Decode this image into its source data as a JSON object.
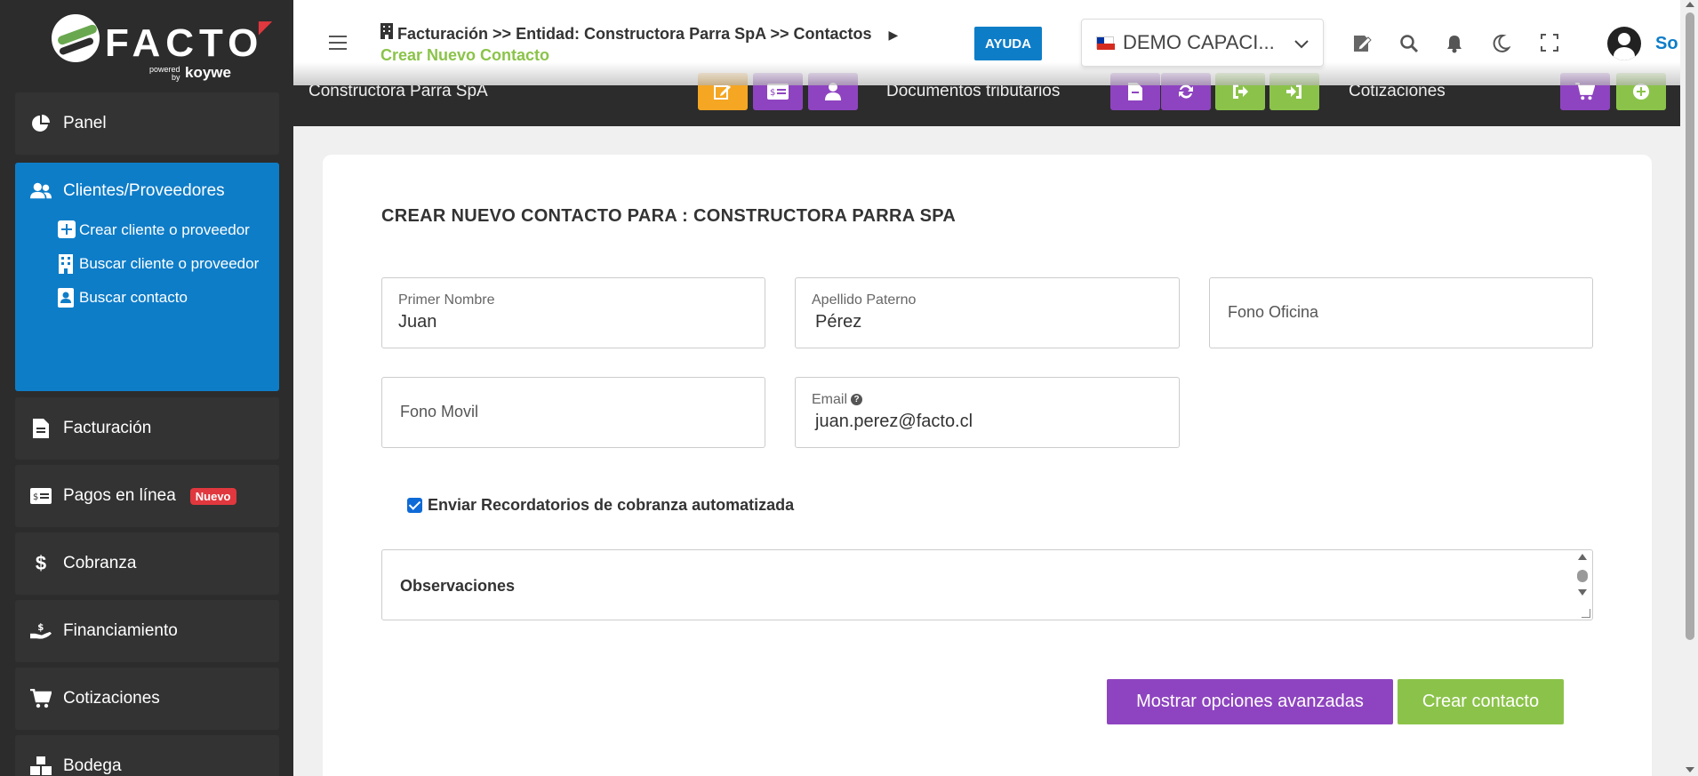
{
  "logo": {
    "word": "FACTO",
    "powered": "powered\nby",
    "brand": "koywe"
  },
  "sidebar": {
    "items": [
      {
        "label": "Panel"
      },
      {
        "label": "Clientes/Proveedores",
        "sub": [
          {
            "label": "Crear cliente o proveedor"
          },
          {
            "label": "Buscar cliente o proveedor"
          },
          {
            "label": "Buscar contacto"
          }
        ]
      },
      {
        "label": "Facturación"
      },
      {
        "label": "Pagos en línea",
        "badge": "Nuevo"
      },
      {
        "label": "Cobranza"
      },
      {
        "label": "Financiamiento"
      },
      {
        "label": "Cotizaciones"
      },
      {
        "label": "Bodega"
      }
    ]
  },
  "header": {
    "breadcrumb": "Facturación >> Entidad: Constructora Parra SpA >> Contactos",
    "breadcrumb_sub": "Crear Nuevo Contacto",
    "help_label": "AYUDA",
    "company": "DEMO CAPACI...",
    "user_text": "So"
  },
  "band": {
    "entity": "Constructora Parra SpA",
    "docs_label": "Documentos tributarios",
    "quotes_label": "Cotizaciones"
  },
  "form": {
    "title": "CREAR NUEVO CONTACTO PARA : CONSTRUCTORA PARRA SPA",
    "first_name": {
      "label": "Primer Nombre",
      "value": "Juan"
    },
    "last_name": {
      "label": "Apellido Paterno",
      "value": "Pérez"
    },
    "office_phone": {
      "placeholder": "Fono Oficina"
    },
    "mobile_phone": {
      "placeholder": "Fono Movil"
    },
    "email": {
      "label": "Email",
      "value": "juan.perez@facto.cl"
    },
    "reminder_label": "Enviar Recordatorios de cobranza automatizada",
    "notes_label": "Observaciones",
    "advanced_button": "Mostrar opciones avanzadas",
    "create_button": "Crear contacto"
  },
  "colors": {
    "primary": "#0e7dc8",
    "purple": "#8e44c0",
    "green": "#8bc34a",
    "orange": "#f5a623",
    "danger": "#e0383e"
  }
}
